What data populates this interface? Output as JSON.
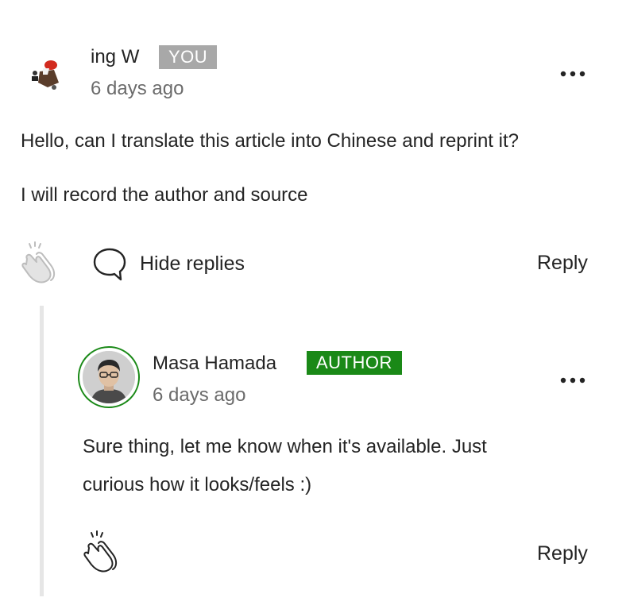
{
  "comment": {
    "author": "ing W",
    "badge": "YOU",
    "time": "6 days ago",
    "paragraphs": [
      "Hello, can I translate this article into Chinese and reprint it?",
      "I will record the author and source"
    ],
    "hide_replies_label": "Hide replies",
    "reply_label": "Reply"
  },
  "reply": {
    "author": "Masa Hamada",
    "badge": "AUTHOR",
    "time": "6 days ago",
    "lines": [
      "Sure thing, let me know when it's available. Just",
      "curious how it looks/feels :)"
    ],
    "reply_label": "Reply"
  },
  "icons": {
    "more": "more-options-icon",
    "clap": "clap-icon",
    "comment": "speech-bubble-icon"
  },
  "colors": {
    "author_badge": "#1a8917",
    "you_badge": "#a8a8a8",
    "secondary_text": "#6b6b6b",
    "thread_line": "#e6e6e6"
  }
}
